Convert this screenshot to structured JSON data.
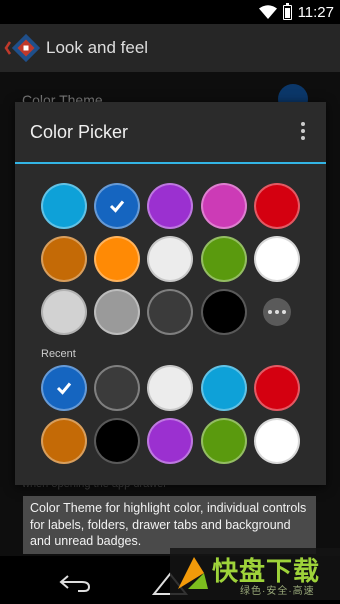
{
  "status_bar": {
    "time": "11:27"
  },
  "action_bar": {
    "title": "Look and feel",
    "icon": "app-logo-icon"
  },
  "background_preference": {
    "title": "Color Theme",
    "summary": "when opening the app drawer",
    "current_color": "#1565c0"
  },
  "dialog": {
    "title": "Color Picker",
    "menu_icon": "overflow-menu-icon",
    "accent_color": "#33b5e5",
    "palette": [
      {
        "color": "#0ea1d8",
        "selected": false
      },
      {
        "color": "#1565c0",
        "selected": true
      },
      {
        "color": "#9b30d0",
        "selected": false
      },
      {
        "color": "#cc3bb6",
        "selected": false
      },
      {
        "color": "#d40010",
        "selected": false
      },
      {
        "color": "#c46a06",
        "selected": false
      },
      {
        "color": "#ff8a05",
        "selected": false
      },
      {
        "color": "#ececec",
        "selected": false
      },
      {
        "color": "#5a9a0e",
        "selected": false
      },
      {
        "color": "#ffffff",
        "selected": false
      },
      {
        "color": "#d2d2d2",
        "selected": false
      },
      {
        "color": "#9a9a9a",
        "selected": false
      },
      {
        "color": "#3b3b3b",
        "selected": false
      },
      {
        "color": "#000000",
        "selected": false
      }
    ],
    "more_icon": "more-colors-icon",
    "recent_label": "Recent",
    "recent": [
      {
        "color": "#1565c0",
        "selected": true
      },
      {
        "color": "#3b3b3b",
        "selected": false
      },
      {
        "color": "#ececec",
        "selected": false
      },
      {
        "color": "#0ea1d8",
        "selected": false
      },
      {
        "color": "#d40010",
        "selected": false
      },
      {
        "color": "#c46a06",
        "selected": false
      },
      {
        "color": "#000000",
        "selected": false
      },
      {
        "color": "#9b30d0",
        "selected": false
      },
      {
        "color": "#5a9a0e",
        "selected": false
      },
      {
        "color": "#ffffff",
        "selected": false
      }
    ]
  },
  "toast": {
    "text": "Color Theme for highlight color, individual controls for labels,  folders, drawer tabs and background and unread badges."
  },
  "nav_bar": {
    "back_icon": "back-icon",
    "home_icon": "home-icon"
  },
  "watermark": {
    "big": "快盘下载",
    "small": "绿色·安全·高速"
  }
}
